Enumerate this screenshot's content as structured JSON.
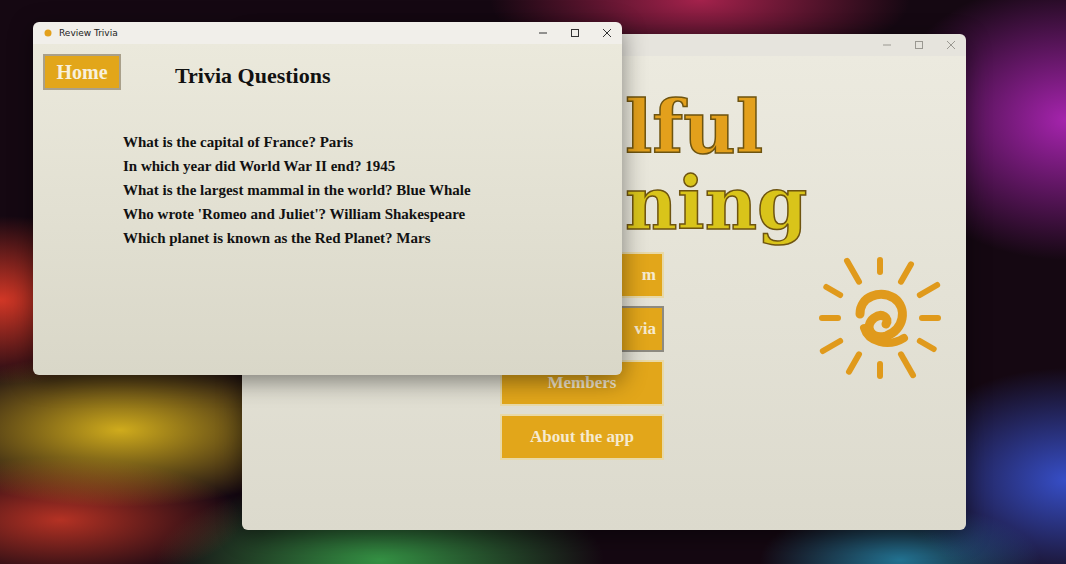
{
  "main_window": {
    "title_lines": [
      {
        "text": "lful",
        "color": "#e3a01c"
      },
      {
        "text": "ning",
        "color": "#d9c41a"
      }
    ],
    "buttons": [
      {
        "label": "m",
        "focused": false
      },
      {
        "label": "via",
        "focused": true
      },
      {
        "label": "Members",
        "focused": false
      },
      {
        "label": "About the app",
        "focused": false
      }
    ]
  },
  "trivia_window": {
    "title": "Review Trivia",
    "home_button": "Home",
    "heading": "Trivia Questions",
    "questions": [
      {
        "text": "What is the capital of France? Paris"
      },
      {
        "text": "In which year did World War II end? 1945"
      },
      {
        "text": "What is the largest mammal in the world? Blue Whale"
      },
      {
        "text": "Who wrote 'Romeo and Juliet'? William Shakespeare"
      },
      {
        "text": "Which planet is known as the Red Planet? Mars"
      }
    ]
  }
}
